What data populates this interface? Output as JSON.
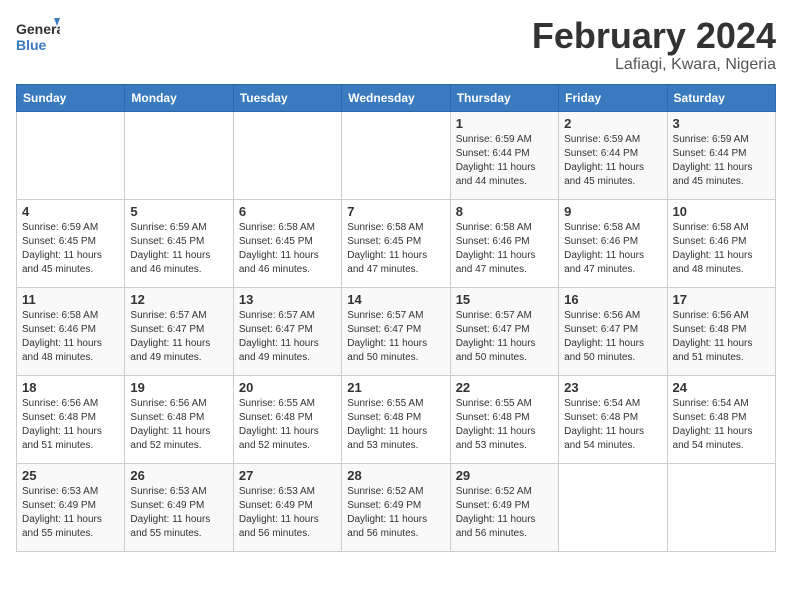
{
  "header": {
    "logo_general": "General",
    "logo_blue": "Blue",
    "title": "February 2024",
    "subtitle": "Lafiagi, Kwara, Nigeria"
  },
  "columns": [
    "Sunday",
    "Monday",
    "Tuesday",
    "Wednesday",
    "Thursday",
    "Friday",
    "Saturday"
  ],
  "weeks": [
    [
      {
        "day": "",
        "info": ""
      },
      {
        "day": "",
        "info": ""
      },
      {
        "day": "",
        "info": ""
      },
      {
        "day": "",
        "info": ""
      },
      {
        "day": "1",
        "info": "Sunrise: 6:59 AM\nSunset: 6:44 PM\nDaylight: 11 hours\nand 44 minutes."
      },
      {
        "day": "2",
        "info": "Sunrise: 6:59 AM\nSunset: 6:44 PM\nDaylight: 11 hours\nand 45 minutes."
      },
      {
        "day": "3",
        "info": "Sunrise: 6:59 AM\nSunset: 6:44 PM\nDaylight: 11 hours\nand 45 minutes."
      }
    ],
    [
      {
        "day": "4",
        "info": "Sunrise: 6:59 AM\nSunset: 6:45 PM\nDaylight: 11 hours\nand 45 minutes."
      },
      {
        "day": "5",
        "info": "Sunrise: 6:59 AM\nSunset: 6:45 PM\nDaylight: 11 hours\nand 46 minutes."
      },
      {
        "day": "6",
        "info": "Sunrise: 6:58 AM\nSunset: 6:45 PM\nDaylight: 11 hours\nand 46 minutes."
      },
      {
        "day": "7",
        "info": "Sunrise: 6:58 AM\nSunset: 6:45 PM\nDaylight: 11 hours\nand 47 minutes."
      },
      {
        "day": "8",
        "info": "Sunrise: 6:58 AM\nSunset: 6:46 PM\nDaylight: 11 hours\nand 47 minutes."
      },
      {
        "day": "9",
        "info": "Sunrise: 6:58 AM\nSunset: 6:46 PM\nDaylight: 11 hours\nand 47 minutes."
      },
      {
        "day": "10",
        "info": "Sunrise: 6:58 AM\nSunset: 6:46 PM\nDaylight: 11 hours\nand 48 minutes."
      }
    ],
    [
      {
        "day": "11",
        "info": "Sunrise: 6:58 AM\nSunset: 6:46 PM\nDaylight: 11 hours\nand 48 minutes."
      },
      {
        "day": "12",
        "info": "Sunrise: 6:57 AM\nSunset: 6:47 PM\nDaylight: 11 hours\nand 49 minutes."
      },
      {
        "day": "13",
        "info": "Sunrise: 6:57 AM\nSunset: 6:47 PM\nDaylight: 11 hours\nand 49 minutes."
      },
      {
        "day": "14",
        "info": "Sunrise: 6:57 AM\nSunset: 6:47 PM\nDaylight: 11 hours\nand 50 minutes."
      },
      {
        "day": "15",
        "info": "Sunrise: 6:57 AM\nSunset: 6:47 PM\nDaylight: 11 hours\nand 50 minutes."
      },
      {
        "day": "16",
        "info": "Sunrise: 6:56 AM\nSunset: 6:47 PM\nDaylight: 11 hours\nand 50 minutes."
      },
      {
        "day": "17",
        "info": "Sunrise: 6:56 AM\nSunset: 6:48 PM\nDaylight: 11 hours\nand 51 minutes."
      }
    ],
    [
      {
        "day": "18",
        "info": "Sunrise: 6:56 AM\nSunset: 6:48 PM\nDaylight: 11 hours\nand 51 minutes."
      },
      {
        "day": "19",
        "info": "Sunrise: 6:56 AM\nSunset: 6:48 PM\nDaylight: 11 hours\nand 52 minutes."
      },
      {
        "day": "20",
        "info": "Sunrise: 6:55 AM\nSunset: 6:48 PM\nDaylight: 11 hours\nand 52 minutes."
      },
      {
        "day": "21",
        "info": "Sunrise: 6:55 AM\nSunset: 6:48 PM\nDaylight: 11 hours\nand 53 minutes."
      },
      {
        "day": "22",
        "info": "Sunrise: 6:55 AM\nSunset: 6:48 PM\nDaylight: 11 hours\nand 53 minutes."
      },
      {
        "day": "23",
        "info": "Sunrise: 6:54 AM\nSunset: 6:48 PM\nDaylight: 11 hours\nand 54 minutes."
      },
      {
        "day": "24",
        "info": "Sunrise: 6:54 AM\nSunset: 6:48 PM\nDaylight: 11 hours\nand 54 minutes."
      }
    ],
    [
      {
        "day": "25",
        "info": "Sunrise: 6:53 AM\nSunset: 6:49 PM\nDaylight: 11 hours\nand 55 minutes."
      },
      {
        "day": "26",
        "info": "Sunrise: 6:53 AM\nSunset: 6:49 PM\nDaylight: 11 hours\nand 55 minutes."
      },
      {
        "day": "27",
        "info": "Sunrise: 6:53 AM\nSunset: 6:49 PM\nDaylight: 11 hours\nand 56 minutes."
      },
      {
        "day": "28",
        "info": "Sunrise: 6:52 AM\nSunset: 6:49 PM\nDaylight: 11 hours\nand 56 minutes."
      },
      {
        "day": "29",
        "info": "Sunrise: 6:52 AM\nSunset: 6:49 PM\nDaylight: 11 hours\nand 56 minutes."
      },
      {
        "day": "",
        "info": ""
      },
      {
        "day": "",
        "info": ""
      }
    ]
  ]
}
